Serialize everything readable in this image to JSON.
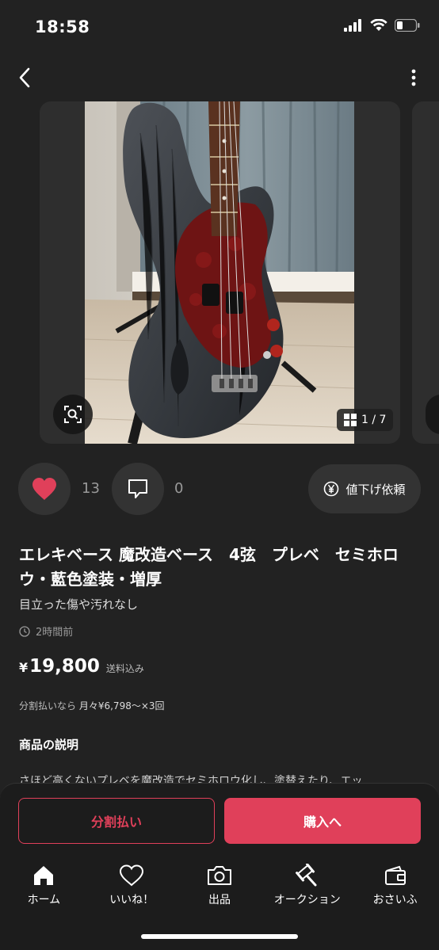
{
  "status_bar": {
    "time": "18:58"
  },
  "gallery": {
    "counter": "1 / 7"
  },
  "actions": {
    "like_count": "13",
    "comment_count": "0",
    "price_down_label": "値下げ依頼"
  },
  "item": {
    "title": "エレキベース 魔改造ベース　4弦　プレベ　セミホロウ・藍色塗装・増厚",
    "condition": "目立った傷や汚れなし",
    "posted": "2時間前",
    "currency": "¥",
    "price": "19,800",
    "shipping": "送料込み",
    "installment_prefix": "分割払いなら",
    "installment_detail": "月々¥6,798〜×3回",
    "description_heading": "商品の説明",
    "description": "さほど高くないプレベを魔改造でセミホロウ化し、塗替えたり、エッ"
  },
  "buttons": {
    "split_pay": "分割払い",
    "buy": "購入へ"
  },
  "tabbar": [
    {
      "label": "ホーム",
      "icon": "home-icon"
    },
    {
      "label": "いいね！",
      "icon": "heart-icon"
    },
    {
      "label": "出品",
      "icon": "camera-icon"
    },
    {
      "label": "オークション",
      "icon": "gavel-icon"
    },
    {
      "label": "おさいふ",
      "icon": "wallet-icon"
    }
  ],
  "colors": {
    "accent": "#e0405a",
    "background": "#222222"
  }
}
